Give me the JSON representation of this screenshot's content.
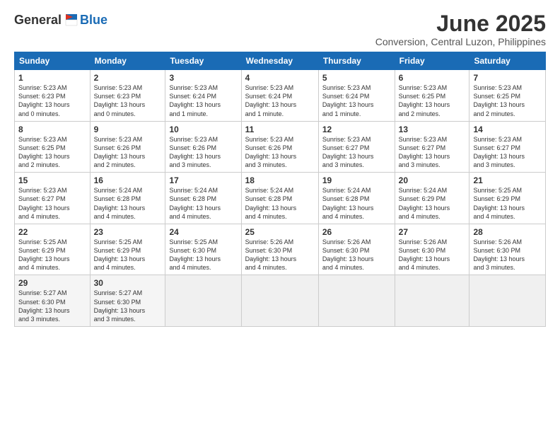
{
  "logo": {
    "general": "General",
    "blue": "Blue"
  },
  "title": "June 2025",
  "subtitle": "Conversion, Central Luzon, Philippines",
  "headers": [
    "Sunday",
    "Monday",
    "Tuesday",
    "Wednesday",
    "Thursday",
    "Friday",
    "Saturday"
  ],
  "weeks": [
    [
      {
        "day": "1",
        "lines": [
          "Sunrise: 5:23 AM",
          "Sunset: 6:23 PM",
          "Daylight: 13 hours",
          "and 0 minutes."
        ]
      },
      {
        "day": "2",
        "lines": [
          "Sunrise: 5:23 AM",
          "Sunset: 6:23 PM",
          "Daylight: 13 hours",
          "and 0 minutes."
        ]
      },
      {
        "day": "3",
        "lines": [
          "Sunrise: 5:23 AM",
          "Sunset: 6:24 PM",
          "Daylight: 13 hours",
          "and 1 minute."
        ]
      },
      {
        "day": "4",
        "lines": [
          "Sunrise: 5:23 AM",
          "Sunset: 6:24 PM",
          "Daylight: 13 hours",
          "and 1 minute."
        ]
      },
      {
        "day": "5",
        "lines": [
          "Sunrise: 5:23 AM",
          "Sunset: 6:24 PM",
          "Daylight: 13 hours",
          "and 1 minute."
        ]
      },
      {
        "day": "6",
        "lines": [
          "Sunrise: 5:23 AM",
          "Sunset: 6:25 PM",
          "Daylight: 13 hours",
          "and 2 minutes."
        ]
      },
      {
        "day": "7",
        "lines": [
          "Sunrise: 5:23 AM",
          "Sunset: 6:25 PM",
          "Daylight: 13 hours",
          "and 2 minutes."
        ]
      }
    ],
    [
      {
        "day": "8",
        "lines": [
          "Sunrise: 5:23 AM",
          "Sunset: 6:25 PM",
          "Daylight: 13 hours",
          "and 2 minutes."
        ]
      },
      {
        "day": "9",
        "lines": [
          "Sunrise: 5:23 AM",
          "Sunset: 6:26 PM",
          "Daylight: 13 hours",
          "and 2 minutes."
        ]
      },
      {
        "day": "10",
        "lines": [
          "Sunrise: 5:23 AM",
          "Sunset: 6:26 PM",
          "Daylight: 13 hours",
          "and 3 minutes."
        ]
      },
      {
        "day": "11",
        "lines": [
          "Sunrise: 5:23 AM",
          "Sunset: 6:26 PM",
          "Daylight: 13 hours",
          "and 3 minutes."
        ]
      },
      {
        "day": "12",
        "lines": [
          "Sunrise: 5:23 AM",
          "Sunset: 6:27 PM",
          "Daylight: 13 hours",
          "and 3 minutes."
        ]
      },
      {
        "day": "13",
        "lines": [
          "Sunrise: 5:23 AM",
          "Sunset: 6:27 PM",
          "Daylight: 13 hours",
          "and 3 minutes."
        ]
      },
      {
        "day": "14",
        "lines": [
          "Sunrise: 5:23 AM",
          "Sunset: 6:27 PM",
          "Daylight: 13 hours",
          "and 3 minutes."
        ]
      }
    ],
    [
      {
        "day": "15",
        "lines": [
          "Sunrise: 5:23 AM",
          "Sunset: 6:27 PM",
          "Daylight: 13 hours",
          "and 4 minutes."
        ]
      },
      {
        "day": "16",
        "lines": [
          "Sunrise: 5:24 AM",
          "Sunset: 6:28 PM",
          "Daylight: 13 hours",
          "and 4 minutes."
        ]
      },
      {
        "day": "17",
        "lines": [
          "Sunrise: 5:24 AM",
          "Sunset: 6:28 PM",
          "Daylight: 13 hours",
          "and 4 minutes."
        ]
      },
      {
        "day": "18",
        "lines": [
          "Sunrise: 5:24 AM",
          "Sunset: 6:28 PM",
          "Daylight: 13 hours",
          "and 4 minutes."
        ]
      },
      {
        "day": "19",
        "lines": [
          "Sunrise: 5:24 AM",
          "Sunset: 6:28 PM",
          "Daylight: 13 hours",
          "and 4 minutes."
        ]
      },
      {
        "day": "20",
        "lines": [
          "Sunrise: 5:24 AM",
          "Sunset: 6:29 PM",
          "Daylight: 13 hours",
          "and 4 minutes."
        ]
      },
      {
        "day": "21",
        "lines": [
          "Sunrise: 5:25 AM",
          "Sunset: 6:29 PM",
          "Daylight: 13 hours",
          "and 4 minutes."
        ]
      }
    ],
    [
      {
        "day": "22",
        "lines": [
          "Sunrise: 5:25 AM",
          "Sunset: 6:29 PM",
          "Daylight: 13 hours",
          "and 4 minutes."
        ]
      },
      {
        "day": "23",
        "lines": [
          "Sunrise: 5:25 AM",
          "Sunset: 6:29 PM",
          "Daylight: 13 hours",
          "and 4 minutes."
        ]
      },
      {
        "day": "24",
        "lines": [
          "Sunrise: 5:25 AM",
          "Sunset: 6:30 PM",
          "Daylight: 13 hours",
          "and 4 minutes."
        ]
      },
      {
        "day": "25",
        "lines": [
          "Sunrise: 5:26 AM",
          "Sunset: 6:30 PM",
          "Daylight: 13 hours",
          "and 4 minutes."
        ]
      },
      {
        "day": "26",
        "lines": [
          "Sunrise: 5:26 AM",
          "Sunset: 6:30 PM",
          "Daylight: 13 hours",
          "and 4 minutes."
        ]
      },
      {
        "day": "27",
        "lines": [
          "Sunrise: 5:26 AM",
          "Sunset: 6:30 PM",
          "Daylight: 13 hours",
          "and 4 minutes."
        ]
      },
      {
        "day": "28",
        "lines": [
          "Sunrise: 5:26 AM",
          "Sunset: 6:30 PM",
          "Daylight: 13 hours",
          "and 3 minutes."
        ]
      }
    ],
    [
      {
        "day": "29",
        "lines": [
          "Sunrise: 5:27 AM",
          "Sunset: 6:30 PM",
          "Daylight: 13 hours",
          "and 3 minutes."
        ]
      },
      {
        "day": "30",
        "lines": [
          "Sunrise: 5:27 AM",
          "Sunset: 6:30 PM",
          "Daylight: 13 hours",
          "and 3 minutes."
        ]
      },
      {
        "day": "",
        "lines": []
      },
      {
        "day": "",
        "lines": []
      },
      {
        "day": "",
        "lines": []
      },
      {
        "day": "",
        "lines": []
      },
      {
        "day": "",
        "lines": []
      }
    ]
  ]
}
